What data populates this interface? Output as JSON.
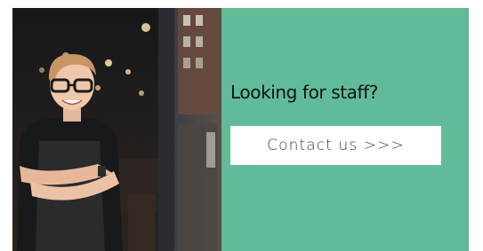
{
  "banner": {
    "headline": "Looking for staff?",
    "cta_label": "Contact us >>>",
    "accent_color": "#62bb98",
    "photo_description_icon": "person-photo-icon"
  }
}
